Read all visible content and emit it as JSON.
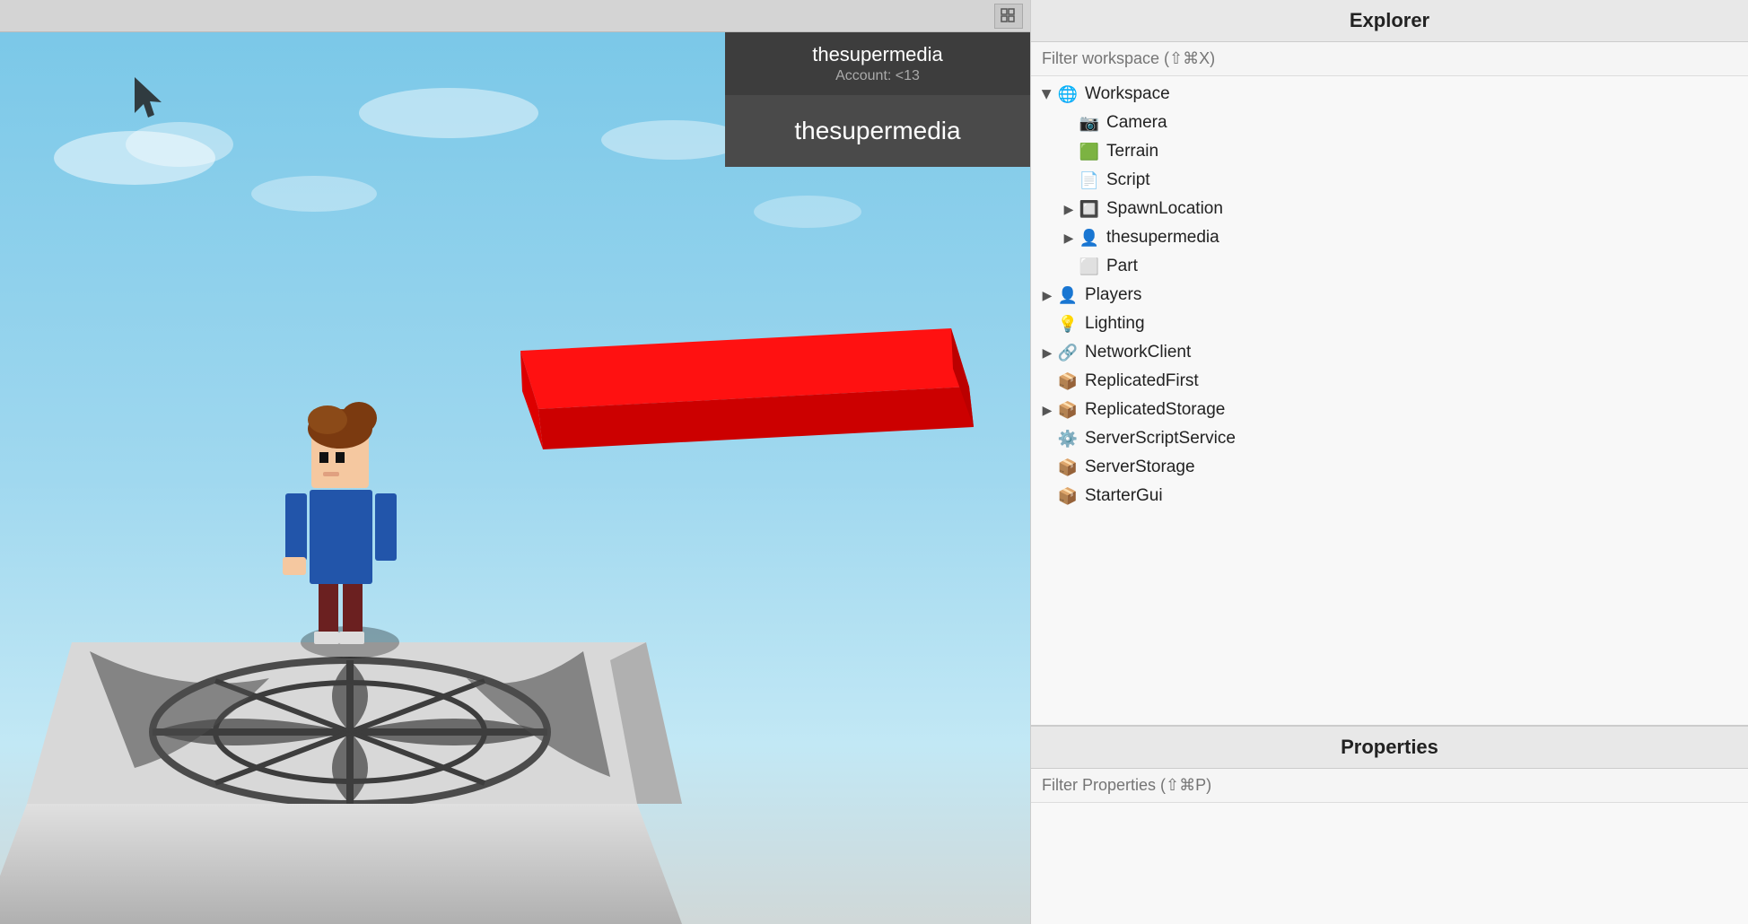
{
  "topbar": {
    "grid_icon": "⊞"
  },
  "user": {
    "username": "thesupermedia",
    "account_label": "Account: <13",
    "display_name": "thesupermedia"
  },
  "explorer": {
    "title": "Explorer",
    "filter_placeholder": "Filter workspace (⇧⌘X)",
    "tree": [
      {
        "id": "workspace",
        "label": "Workspace",
        "icon": "globe",
        "indent": 0,
        "expanded": true,
        "arrow": "expanded"
      },
      {
        "id": "camera",
        "label": "Camera",
        "icon": "camera",
        "indent": 1,
        "arrow": "empty"
      },
      {
        "id": "terrain",
        "label": "Terrain",
        "icon": "terrain",
        "indent": 1,
        "arrow": "empty"
      },
      {
        "id": "script",
        "label": "Script",
        "icon": "script",
        "indent": 1,
        "arrow": "empty"
      },
      {
        "id": "spawnlocation",
        "label": "SpawnLocation",
        "icon": "spawn",
        "indent": 1,
        "arrow": "collapsed"
      },
      {
        "id": "thesupermedia",
        "label": "thesupermedia",
        "icon": "player",
        "indent": 1,
        "arrow": "collapsed"
      },
      {
        "id": "part",
        "label": "Part",
        "icon": "part",
        "indent": 1,
        "arrow": "empty"
      },
      {
        "id": "players",
        "label": "Players",
        "icon": "player",
        "indent": 0,
        "arrow": "collapsed"
      },
      {
        "id": "lighting",
        "label": "Lighting",
        "icon": "lighting",
        "indent": 0,
        "arrow": "empty"
      },
      {
        "id": "networkclient",
        "label": "NetworkClient",
        "icon": "network",
        "indent": 0,
        "arrow": "collapsed"
      },
      {
        "id": "replicatedfirst",
        "label": "ReplicatedFirst",
        "icon": "storage",
        "indent": 0,
        "arrow": "empty"
      },
      {
        "id": "replicatedstorage",
        "label": "ReplicatedStorage",
        "icon": "storage",
        "indent": 0,
        "arrow": "collapsed"
      },
      {
        "id": "serverscriptservice",
        "label": "ServerScriptService",
        "icon": "service",
        "indent": 0,
        "arrow": "empty"
      },
      {
        "id": "serverstorage",
        "label": "ServerStorage",
        "icon": "storage",
        "indent": 0,
        "arrow": "empty"
      },
      {
        "id": "startergui",
        "label": "StarterGui",
        "icon": "storage",
        "indent": 0,
        "arrow": "empty"
      }
    ]
  },
  "properties": {
    "title": "Properties",
    "filter_placeholder": "Filter Properties (⇧⌘P)"
  }
}
